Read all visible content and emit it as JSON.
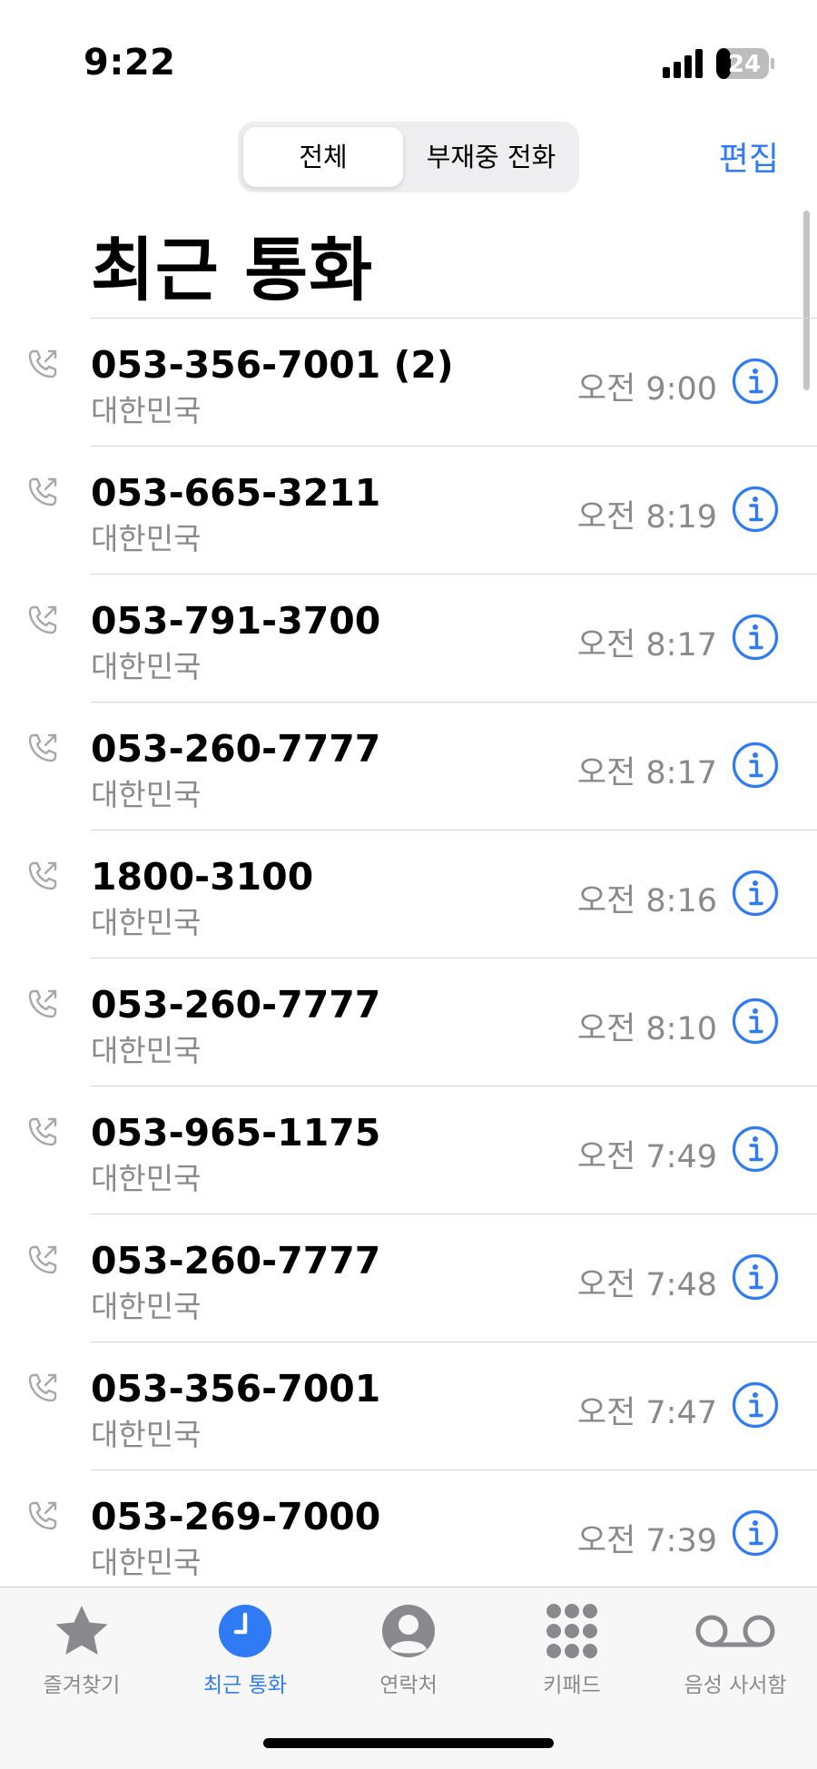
{
  "status_bar": {
    "time": "9:22",
    "battery": "24"
  },
  "header": {
    "segments": [
      "전체",
      "부재중 전화"
    ],
    "selected_segment": "전체",
    "edit_label": "편집",
    "title": "최근 통화"
  },
  "calls": [
    {
      "number": "053-356-7001 (2)",
      "location": "대한민국",
      "time": "오전 9:00"
    },
    {
      "number": "053-665-3211",
      "location": "대한민국",
      "time": "오전 8:19"
    },
    {
      "number": "053-791-3700",
      "location": "대한민국",
      "time": "오전 8:17"
    },
    {
      "number": "053-260-7777",
      "location": "대한민국",
      "time": "오전 8:17"
    },
    {
      "number": "1800-3100",
      "location": "대한민국",
      "time": "오전 8:16"
    },
    {
      "number": "053-260-7777",
      "location": "대한민국",
      "time": "오전 8:10"
    },
    {
      "number": "053-965-1175",
      "location": "대한민국",
      "time": "오전 7:49"
    },
    {
      "number": "053-260-7777",
      "location": "대한민국",
      "time": "오전 7:48"
    },
    {
      "number": "053-356-7001",
      "location": "대한민국",
      "time": "오전 7:47"
    },
    {
      "number": "053-269-7000",
      "location": "대한민국",
      "time": "오전 7:39"
    }
  ],
  "tab_bar": {
    "items": [
      {
        "label": "즐겨찾기",
        "icon": "star-icon"
      },
      {
        "label": "최근 통화",
        "icon": "clock-icon"
      },
      {
        "label": "연락처",
        "icon": "person-icon"
      },
      {
        "label": "키패드",
        "icon": "keypad-icon"
      },
      {
        "label": "음성 사서함",
        "icon": "voicemail-icon"
      }
    ],
    "active": "최근 통화"
  },
  "colors": {
    "accent": "#2f7bf5",
    "secondary_text": "#8a8a8e",
    "tab_inactive": "#8a8a8e"
  }
}
